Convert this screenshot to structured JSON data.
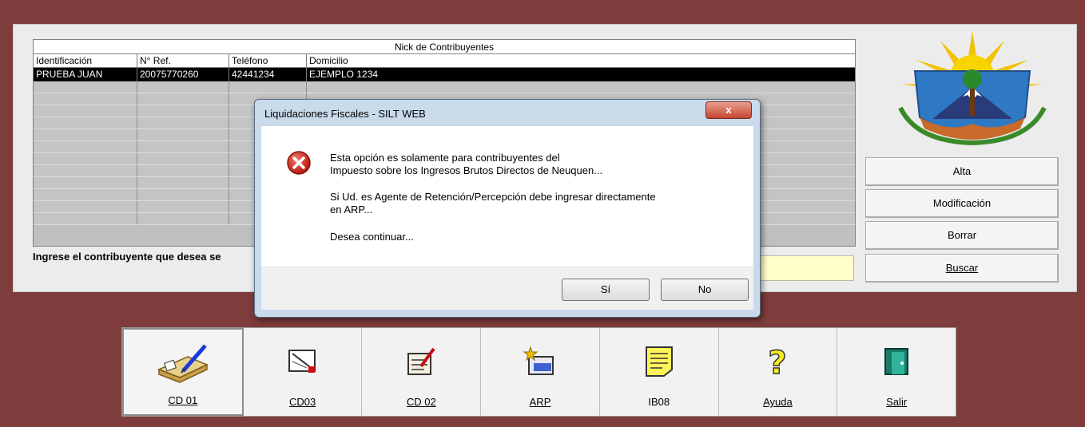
{
  "grid": {
    "title": "Nick de Contribuyentes",
    "columns": [
      "Identificación",
      "N° Ref.",
      "Teléfono",
      "Domicilio"
    ],
    "selected_row": [
      "PRUEBA JUAN",
      "20075770260",
      "42441234",
      "EJEMPLO 1234"
    ]
  },
  "prompt": "Ingrese el contribuyente que desea se",
  "side_buttons": {
    "alta": "Alta",
    "modificacion": "Modificación",
    "borrar": "Borrar",
    "buscar": "Buscar"
  },
  "toolbar": [
    {
      "label": "CD 01",
      "icon": "book-pen-icon"
    },
    {
      "label": "CD03",
      "icon": "document-edit-icon"
    },
    {
      "label": "CD 02",
      "icon": "notepad-icon"
    },
    {
      "label": "ARP",
      "icon": "new-folder-icon"
    },
    {
      "label": "IB08",
      "icon": "yellow-note-icon"
    },
    {
      "label": "Ayuda",
      "icon": "question-icon"
    },
    {
      "label": "Salir",
      "icon": "exit-door-icon"
    }
  ],
  "dialog": {
    "title": "Liquidaciones Fiscales - SILT WEB",
    "close": "x",
    "line1": "Esta opción es solamente para contribuyentes del",
    "line2": "Impuesto sobre los Ingresos Brutos Directos de Neuquen...",
    "line3": "Si Ud. es Agente de Retención/Percepción debe ingresar directamente",
    "line4": "en ARP...",
    "line5": "Desea continuar...",
    "yes": "Sí",
    "no": "No",
    "icon": "error-icon"
  },
  "colors": {
    "desktop": "#7e3c3c",
    "selection": "#000000",
    "highlight_field": "#ffffc8"
  }
}
